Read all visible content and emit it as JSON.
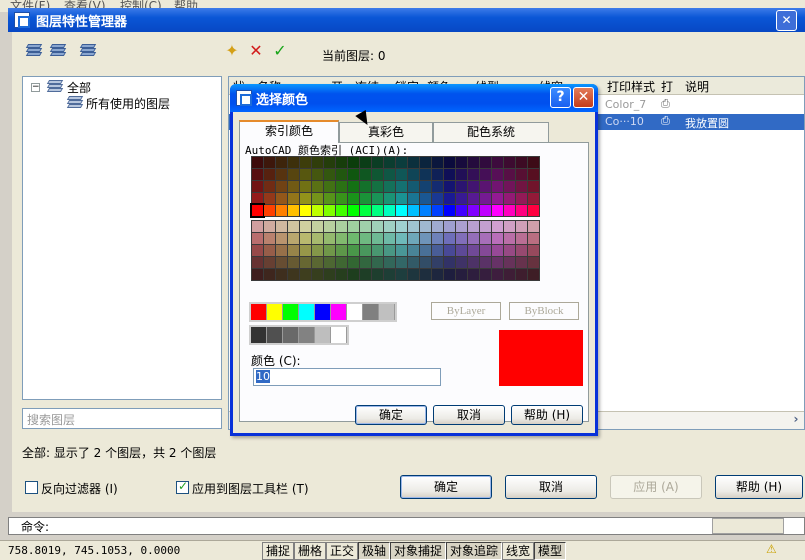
{
  "menu": [
    "文件(F)",
    "查看(V)",
    "控制(C)",
    "帮助"
  ],
  "layer_manager": {
    "title": "图层特性管理器",
    "close_glyph": "✕",
    "current_layer": "当前图层: 0",
    "tree": {
      "expander": "−",
      "root": "全部",
      "child": "所有使用的图层"
    },
    "search_placeholder": "搜索图层",
    "columns": [
      "状",
      "名称",
      "开",
      "冻结",
      "锁定",
      "颜色",
      "线型",
      "线宽",
      "打印样式",
      "打",
      "说明"
    ],
    "rows": [
      {
        "plot_style": "Color_7",
        "description": ""
      },
      {
        "plot_style": "Co···10",
        "description": "我放置圆"
      }
    ],
    "status": "全部: 显示了 2 个图层，共 2 个图层",
    "invert_filter_label": "反向过滤器 (I)",
    "apply_toolbar_label": "应用到图层工具栏 (T)",
    "buttons": {
      "ok": "确定",
      "cancel": "取消",
      "apply": "应用 (A)",
      "help": "帮助 (H)"
    },
    "scroll_right": "›"
  },
  "dialog": {
    "title": "选择颜色",
    "help_glyph": "?",
    "close_glyph": "✕",
    "tabs": [
      "索引颜色",
      "真彩色",
      "配色系统"
    ],
    "active_tab": 0,
    "aci_label": "AutoCAD 颜色索引 (ACI)(A):",
    "bylayer": "ByLayer",
    "byblock": "ByBlock",
    "color_label": "颜色 (C):",
    "color_value": "10",
    "preview_color": "#ff0000",
    "selected_swatch": "red",
    "standard_colors": [
      "#ff0000",
      "#ffff00",
      "#00ff00",
      "#00ffff",
      "#0000ff",
      "#ff00ff",
      "#ffffff",
      "#808080",
      "#c0c0c0"
    ],
    "gray_colors": [
      "#333333",
      "#505050",
      "#696969",
      "#828282",
      "#bebebe",
      "#ffffff"
    ],
    "buttons": {
      "ok": "确定",
      "cancel": "取消",
      "help": "帮助 (H)"
    }
  },
  "command": {
    "prompt": "命令:"
  },
  "status_bar": {
    "coords": "758.8019,  745.1053, 0.0000",
    "toggles": [
      "捕捉",
      "栅格",
      "正交",
      "极轴",
      "对象捕捉",
      "对象追踪",
      "线宽",
      "模型"
    ]
  }
}
